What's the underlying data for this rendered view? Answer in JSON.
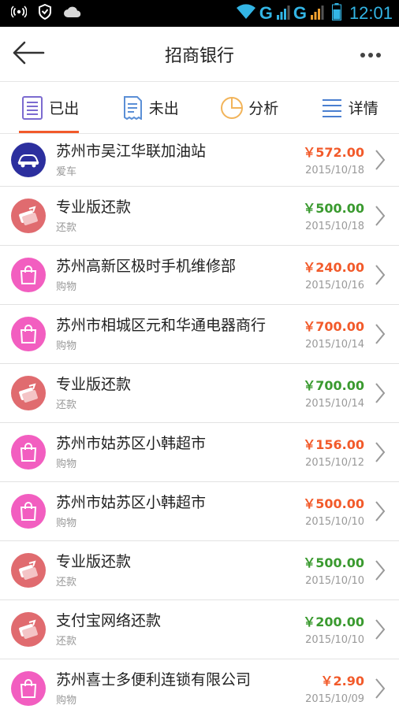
{
  "status_bar": {
    "network_1": "G",
    "network_2": "G",
    "time": "12:01"
  },
  "header": {
    "title": "招商银行"
  },
  "tabs": [
    {
      "label": "已出",
      "icon": "list-doc-icon",
      "active": true
    },
    {
      "label": "未出",
      "icon": "receipt-icon",
      "active": false
    },
    {
      "label": "分析",
      "icon": "pie-chart-icon",
      "active": false
    },
    {
      "label": "详情",
      "icon": "list-lines-icon",
      "active": false
    }
  ],
  "colors": {
    "expense": "#f25a2a",
    "repayment": "#3a9a2f",
    "accent": "#f25a2a",
    "car": "#2c2f9e",
    "shopping": "#f25ec0",
    "repay_icon": "#e06b6f"
  },
  "transactions": [
    {
      "merchant": "苏州市吴江华联加油站",
      "category": "爱车",
      "amount": "￥572.00",
      "date": "2015/10/18",
      "type": "expense",
      "icon": "car-icon"
    },
    {
      "merchant": "专业版还款",
      "category": "还款",
      "amount": "￥500.00",
      "date": "2015/10/18",
      "type": "repayment",
      "icon": "repayment-icon"
    },
    {
      "merchant": "苏州高新区极时手机维修部",
      "category": "购物",
      "amount": "￥240.00",
      "date": "2015/10/16",
      "type": "expense",
      "icon": "shopping-bag-icon"
    },
    {
      "merchant": "苏州市相城区元和华通电器商行",
      "category": "购物",
      "amount": "￥700.00",
      "date": "2015/10/14",
      "type": "expense",
      "icon": "shopping-bag-icon"
    },
    {
      "merchant": "专业版还款",
      "category": "还款",
      "amount": "￥700.00",
      "date": "2015/10/14",
      "type": "repayment",
      "icon": "repayment-icon"
    },
    {
      "merchant": "苏州市姑苏区小韩超市",
      "category": "购物",
      "amount": "￥156.00",
      "date": "2015/10/12",
      "type": "expense",
      "icon": "shopping-bag-icon"
    },
    {
      "merchant": "苏州市姑苏区小韩超市",
      "category": "购物",
      "amount": "￥500.00",
      "date": "2015/10/10",
      "type": "expense",
      "icon": "shopping-bag-icon"
    },
    {
      "merchant": "专业版还款",
      "category": "还款",
      "amount": "￥500.00",
      "date": "2015/10/10",
      "type": "repayment",
      "icon": "repayment-icon"
    },
    {
      "merchant": "支付宝网络还款",
      "category": "还款",
      "amount": "￥200.00",
      "date": "2015/10/10",
      "type": "repayment",
      "icon": "repayment-icon"
    },
    {
      "merchant": "苏州喜士多便利连锁有限公司",
      "category": "购物",
      "amount": "￥2.90",
      "date": "2015/10/09",
      "type": "expense",
      "icon": "shopping-bag-icon"
    }
  ]
}
